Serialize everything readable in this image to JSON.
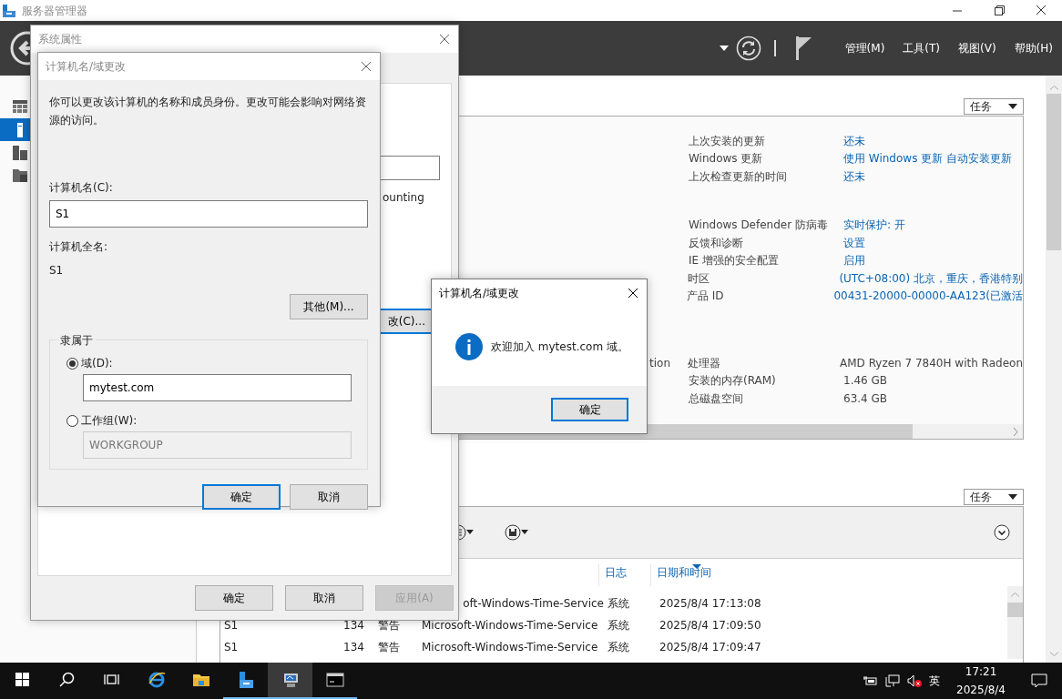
{
  "window": {
    "title": "服务器管理器"
  },
  "header": {
    "menus": [
      "管理(M)",
      "工具(T)",
      "视图(V)",
      "帮助(H)"
    ]
  },
  "sidebar": {
    "items": [
      {
        "kind": "dashboard",
        "selected": false
      },
      {
        "kind": "local",
        "selected": true
      },
      {
        "kind": "servers",
        "selected": false
      },
      {
        "kind": "files",
        "selected": false
      }
    ]
  },
  "properties": {
    "task_button": "任务",
    "cut_text": "tion",
    "groups": [
      {
        "rows": [
          {
            "label": "上次安装的更新",
            "value": "还未",
            "link": true
          },
          {
            "label": "Windows 更新",
            "value": "使用 Windows 更新 自动安装更新",
            "link": true
          },
          {
            "label": "上次检查更新的时间",
            "value": "还未",
            "link": true
          }
        ]
      },
      {
        "rows": [
          {
            "label": "Windows Defender 防病毒",
            "value": "实时保护: 开",
            "link": true
          },
          {
            "label": "反馈和诊断",
            "value": "设置",
            "link": true
          },
          {
            "label": "IE 增强的安全配置",
            "value": "启用",
            "link": true
          },
          {
            "label": "时区",
            "value": "(UTC+08:00) 北京，重庆，香港特别",
            "link": true
          },
          {
            "label": "产品 ID",
            "value": "00431-20000-00000-AA123(已激活",
            "link": true
          }
        ]
      },
      {
        "rows": [
          {
            "label": "处理器",
            "value": "AMD Ryzen 7 7840H with Radeon",
            "link": false
          },
          {
            "label": "安装的内存(RAM)",
            "value": "1.46 GB",
            "link": false
          },
          {
            "label": "总磁盘空间",
            "value": "63.4 GB",
            "link": false
          }
        ]
      }
    ]
  },
  "events": {
    "task_button": "任务",
    "columns": [
      {
        "label": "日志",
        "sorted": false
      },
      {
        "label": "日期和时间",
        "sorted": true
      }
    ],
    "rows": [
      {
        "source": "oft-Windows-Time-Service",
        "log": "系统",
        "date": "2025/8/4 17:13:08"
      },
      {
        "server": "S1",
        "id": "134",
        "level": "警告",
        "source": "Microsoft-Windows-Time-Service",
        "log": "系统",
        "date": "2025/8/4 17:09:50"
      },
      {
        "server": "S1",
        "id": "134",
        "level": "警告",
        "source": "Microsoft-Windows-Time-Service",
        "log": "系统",
        "date": "2025/8/4 17:09:47"
      }
    ]
  },
  "system_properties": {
    "title": "系统属性",
    "cut_text": "ounting",
    "change_button": "改(C)...",
    "buttons": [
      {
        "label": "确定",
        "disabled": false
      },
      {
        "label": "取消",
        "disabled": false
      },
      {
        "label": "应用(A)",
        "disabled": true
      }
    ]
  },
  "computer_name_dialog": {
    "title": "计算机名/域更改",
    "description": "你可以更改该计算机的名称和成员身份。更改可能会影响对网络资源的访问。",
    "name_label": "计算机名(C):",
    "name_value": "S1",
    "full_name_label": "计算机全名:",
    "full_name": "S1",
    "more_button": "其他(M)...",
    "member_of": "隶属于",
    "options": [
      {
        "label": "域(D):",
        "selected": true,
        "value": "mytest.com"
      },
      {
        "label": "工作组(W):",
        "selected": false,
        "value": "WORKGROUP"
      }
    ],
    "buttons": [
      {
        "label": "确定",
        "focused": true
      },
      {
        "label": "取消",
        "focused": false
      }
    ]
  },
  "message_box": {
    "title": "计算机名/域更改",
    "message": "欢迎加入 mytest.com 域。",
    "button": "确定"
  },
  "taskbar": {
    "items": [
      {
        "kind": "start",
        "running": false,
        "active": false
      },
      {
        "kind": "search",
        "running": false,
        "active": false
      },
      {
        "kind": "taskview",
        "running": false,
        "active": false
      },
      {
        "kind": "browser",
        "running": false,
        "active": false
      },
      {
        "kind": "folder",
        "running": false,
        "active": false
      },
      {
        "kind": "server",
        "running": true,
        "active": false
      },
      {
        "kind": "computer",
        "running": true,
        "active": true
      },
      {
        "kind": "console",
        "running": true,
        "active": false
      }
    ],
    "ime": "英",
    "time": "17:21",
    "date": "2025/8/4"
  }
}
